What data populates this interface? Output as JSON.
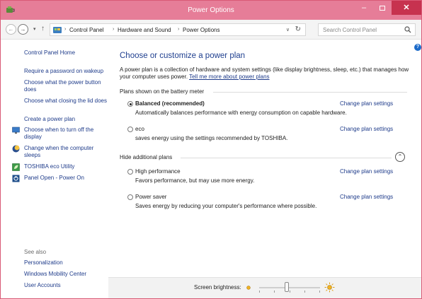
{
  "window": {
    "title": "Power Options",
    "minimize_glyph": "–",
    "close_glyph": "✕"
  },
  "address": {
    "back_glyph": "←",
    "forward_glyph": "→",
    "dropdown_glyph": "▾",
    "up_glyph": "↑",
    "separator_glyph": "›",
    "breadcrumbs": [
      "Control Panel",
      "Hardware and Sound",
      "Power Options"
    ],
    "path_dropdown_glyph": "∨",
    "refresh_glyph": "↻",
    "search_placeholder": "Search Control Panel"
  },
  "sidebar": {
    "home": "Control Panel Home",
    "links": [
      "Require a password on wakeup",
      "Choose what the power button does",
      "Choose what closing the lid does",
      "Create a power plan",
      "Choose when to turn off the display",
      "Change when the computer sleeps",
      "TOSHIBA eco Utility",
      "Panel Open - Power On"
    ],
    "see_also_label": "See also",
    "see_also": [
      "Personalization",
      "Windows Mobility Center",
      "User Accounts"
    ]
  },
  "main": {
    "help_glyph": "?",
    "title": "Choose or customize a power plan",
    "intro_text": "A power plan is a collection of hardware and system settings (like display brightness, sleep, etc.) that manages how your computer uses power.",
    "intro_link": "Tell me more about power plans",
    "battery_group_label": "Plans shown on the battery meter",
    "hidden_group_label": "Hide additional plans",
    "collapse_glyph": "⌃",
    "plans": [
      {
        "name": "Balanced (recommended)",
        "desc": "Automatically balances performance with energy consumption on capable hardware.",
        "link": "Change plan settings",
        "selected": true
      },
      {
        "name": "eco",
        "desc": "saves energy using the settings recommended by TOSHIBA.",
        "link": "Change plan settings",
        "selected": false
      },
      {
        "name": "High performance",
        "desc": "Favors performance, but may use more energy.",
        "link": "Change plan settings",
        "selected": false
      },
      {
        "name": "Power saver",
        "desc": "Saves energy by reducing your computer's performance where possible.",
        "link": "Change plan settings",
        "selected": false
      }
    ]
  },
  "footer": {
    "brightness_label": "Screen brightness:",
    "brightness_level": 0.45
  },
  "colors": {
    "titlebar": "#e67d98",
    "close_button": "#c7324f",
    "link": "#1e3b8a",
    "heading": "#1f3f8f"
  },
  "icons": {
    "app": "power-options-icon",
    "control_panel": "control-panel-icon",
    "search": "search-icon",
    "display_off": "monitor-icon",
    "sleep": "moon-icon",
    "eco_utility": "leaf-icon",
    "panel_open": "panel-open-icon",
    "brightness": "sun-icon"
  }
}
